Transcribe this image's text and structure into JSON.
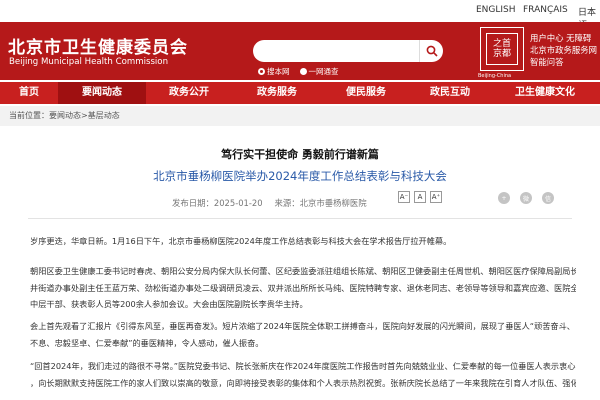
{
  "lang_links": [
    "ENGLISH",
    "FRANÇAIS",
    "日本語"
  ],
  "site": {
    "title": "北京市卫生健康委员会",
    "subtitle": "Beijing Municipal Health Commission"
  },
  "search": {
    "placeholder": "",
    "options": [
      "搜本网",
      "一网通查"
    ],
    "selected": "搜本网"
  },
  "logo": {
    "text_top": "之首",
    "text_bottom": "京都",
    "caption": "Beijing-China"
  },
  "quick_links": [
    "用户中心 无障碍",
    "北京市政务服务网",
    "智能问答"
  ],
  "nav": {
    "items": [
      "首页",
      "要闻动态",
      "政务公开",
      "政务服务",
      "便民服务",
      "政民互动",
      "卫生健康文化"
    ],
    "active": "要闻动态"
  },
  "breadcrumb": "当前位置：要闻动态>基层动态",
  "article": {
    "headline": "笃行实干担使命 勇毅前行谱新篇",
    "title": "北京市垂杨柳医院举办2024年度工作总结表彰与科技大会",
    "date": "发布日期：2025-01-20",
    "source": "来源：北京市垂杨柳医院",
    "font_buttons": [
      "A⁻",
      "A",
      "A⁺"
    ],
    "share_icons": [
      "share-icon",
      "weibo-icon",
      "wechat-icon"
    ],
    "paragraphs": [
      [
        "岁序更迭，华章日新。1月16日下午，北京市垂杨柳医院2024年度工作总结表彰与科技大会在学术报告厅拉开帷幕。"
      ],
      [
        "朝阳区委卫生健康工委书记时春虎、朝阳公安分局内保大队长何蕾、区纪委监委派驻组组长陈斌、朝阳区卫健委副主任周世机、朝阳区医疗保障局副局长吴建伟、双",
        "井街道办事处副主任王蓝万荣、劲松街道办事处二级调研员凌云、双井派出所所长马纯、医院特聘专家、退休老同志、老领导等领导和嘉宾应邀、医院全体领导班子、",
        "中层干部、获表彰人员等200余人参加会议。大会由医院副院长李贵华主持。"
      ],
      [
        "会上首先观看了汇报片《引得东风至，垂医再奋发》。短片浓缩了2024年医院全体职工拼搏奋斗，医院向好发展的闪光瞬间，展现了垂医人“顽苦奋斗、自强",
        "不息、忠毅坚卓、仁爱奉献”的垂医精神，令人感动，催人振奋。"
      ],
      [
        "“回首2024年，我们走过的路很不寻常。”医院党委书记、院长张新庆在作2024年度医院工作报告时首先向兢兢业业、仁爱奉献的每一位垂医人表示衷心感谢",
        "，向长期默默支持医院工作的家人们致以崇高的敬意，向即将接受表彰的集体和个人表示热烈祝贺。张新庆院长总结了一年来我院在引育人才队伍、强化专科建"
      ]
    ]
  }
}
